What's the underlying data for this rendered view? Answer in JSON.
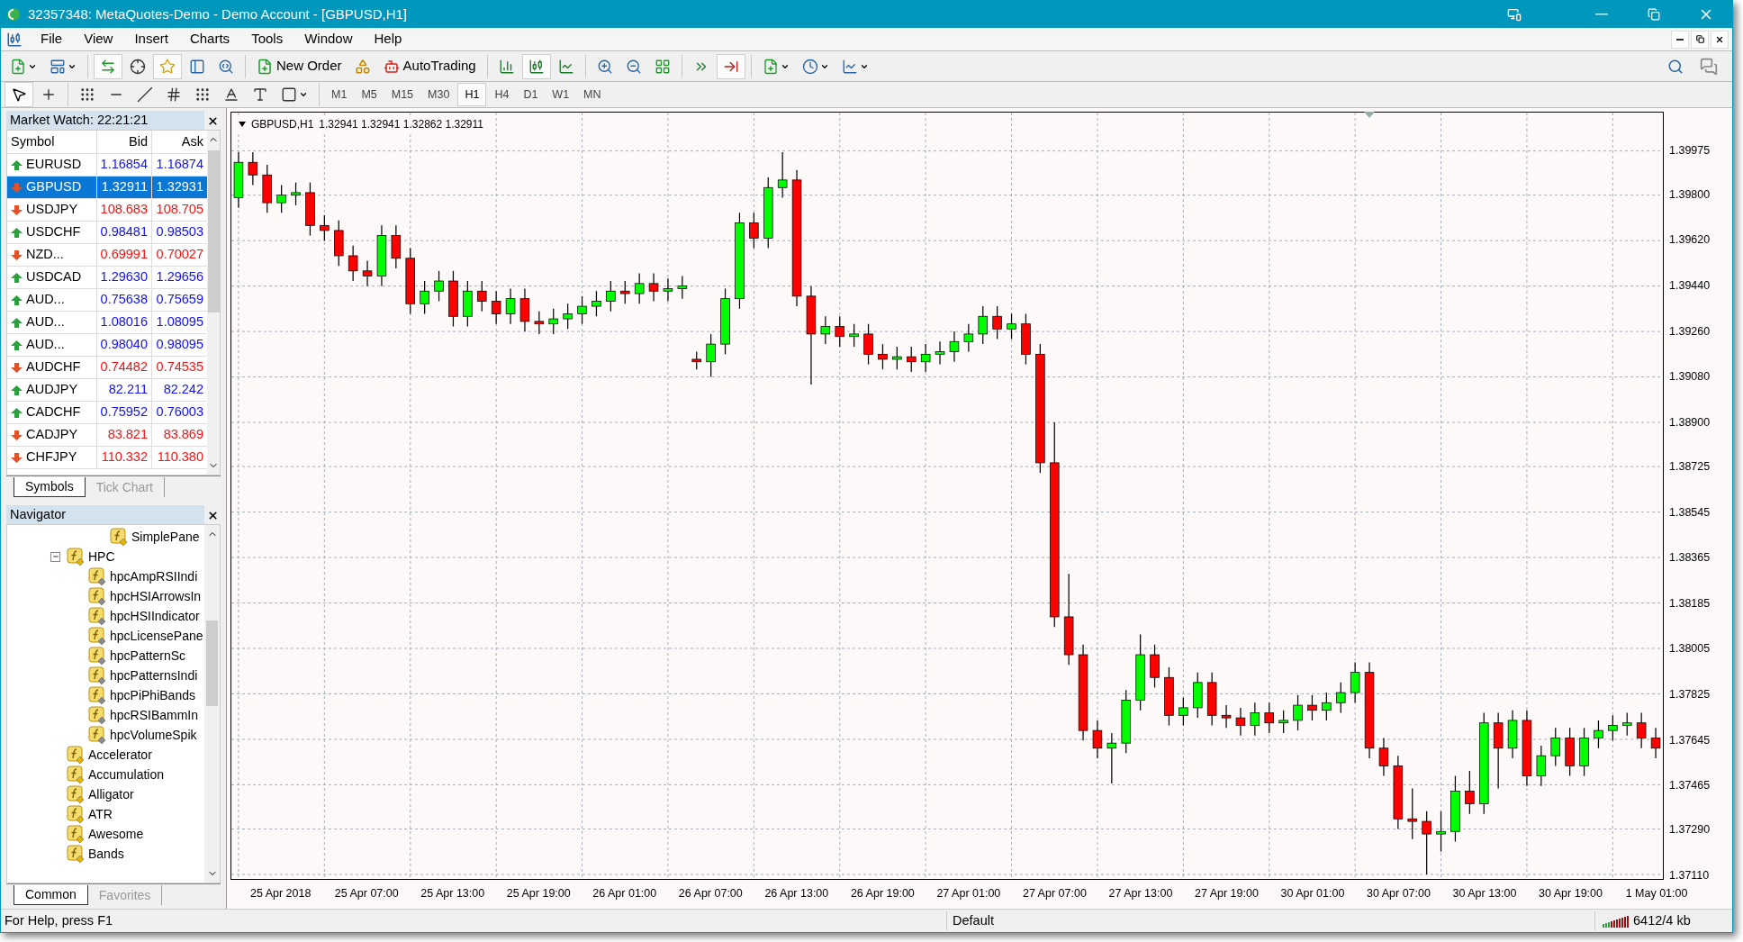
{
  "window": {
    "title": "32357348: MetaQuotes-Demo - Demo Account - [GBPUSD,H1]"
  },
  "menu": [
    "File",
    "View",
    "Insert",
    "Charts",
    "Tools",
    "Window",
    "Help"
  ],
  "toolbar": {
    "new_order": "New Order",
    "autotrading": "AutoTrading"
  },
  "timeframes": [
    {
      "label": "M1",
      "selected": false
    },
    {
      "label": "M5",
      "selected": false
    },
    {
      "label": "M15",
      "selected": false
    },
    {
      "label": "M30",
      "selected": false
    },
    {
      "label": "H1",
      "selected": true
    },
    {
      "label": "H4",
      "selected": false
    },
    {
      "label": "D1",
      "selected": false
    },
    {
      "label": "W1",
      "selected": false
    },
    {
      "label": "MN",
      "selected": false
    }
  ],
  "market_watch": {
    "title": "Market Watch: 22:21:21",
    "columns": [
      "Symbol",
      "Bid",
      "Ask"
    ],
    "rows": [
      {
        "symbol": "EURUSD",
        "bid": "1.16854",
        "ask": "1.16874",
        "rising": true,
        "selected": false
      },
      {
        "symbol": "GBPUSD",
        "bid": "1.32911",
        "ask": "1.32931",
        "rising": false,
        "selected": true
      },
      {
        "symbol": "USDJPY",
        "bid": "108.683",
        "ask": "108.705",
        "rising": false,
        "selected": false
      },
      {
        "symbol": "USDCHF",
        "bid": "0.98481",
        "ask": "0.98503",
        "rising": true,
        "selected": false
      },
      {
        "symbol": "NZD...",
        "bid": "0.69991",
        "ask": "0.70027",
        "rising": false,
        "selected": false
      },
      {
        "symbol": "USDCAD",
        "bid": "1.29630",
        "ask": "1.29656",
        "rising": true,
        "selected": false
      },
      {
        "symbol": "AUD...",
        "bid": "0.75638",
        "ask": "0.75659",
        "rising": true,
        "selected": false
      },
      {
        "symbol": "AUD...",
        "bid": "1.08016",
        "ask": "1.08095",
        "rising": true,
        "selected": false
      },
      {
        "symbol": "AUD...",
        "bid": "0.98040",
        "ask": "0.98095",
        "rising": true,
        "selected": false
      },
      {
        "symbol": "AUDCHF",
        "bid": "0.74482",
        "ask": "0.74535",
        "rising": false,
        "selected": false
      },
      {
        "symbol": "AUDJPY",
        "bid": "82.211",
        "ask": "82.242",
        "rising": true,
        "selected": false
      },
      {
        "symbol": "CADCHF",
        "bid": "0.75952",
        "ask": "0.76003",
        "rising": true,
        "selected": false
      },
      {
        "symbol": "CADJPY",
        "bid": "83.821",
        "ask": "83.869",
        "rising": false,
        "selected": false
      },
      {
        "symbol": "CHFJPY",
        "bid": "110.332",
        "ask": "110.380",
        "rising": false,
        "selected": false
      }
    ],
    "tabs": [
      {
        "label": "Symbols",
        "selected": true
      },
      {
        "label": "Tick Chart",
        "selected": false
      }
    ]
  },
  "navigator": {
    "title": "Navigator",
    "tree": [
      {
        "label": "SimplePane",
        "kind": "indicator"
      },
      {
        "label": "HPC",
        "kind": "folder",
        "expanded": true,
        "children": [
          {
            "label": "hpcAmpRSIIndi",
            "kind": "custom"
          },
          {
            "label": "hpcHSIArrowsIn",
            "kind": "custom"
          },
          {
            "label": "hpcHSIIndicator",
            "kind": "custom"
          },
          {
            "label": "hpcLicensePane",
            "kind": "custom"
          },
          {
            "label": "hpcPatternSc",
            "kind": "custom"
          },
          {
            "label": "hpcPatternsIndi",
            "kind": "custom"
          },
          {
            "label": "hpcPiPhiBands",
            "kind": "custom"
          },
          {
            "label": "hpcRSIBammIn",
            "kind": "custom"
          },
          {
            "label": "hpcVolumeSpik",
            "kind": "custom"
          }
        ]
      },
      {
        "label": "Accelerator",
        "kind": "indicator"
      },
      {
        "label": "Accumulation",
        "kind": "indicator"
      },
      {
        "label": "Alligator",
        "kind": "indicator"
      },
      {
        "label": "ATR",
        "kind": "indicator"
      },
      {
        "label": "Awesome",
        "kind": "indicator"
      },
      {
        "label": "Bands",
        "kind": "indicator"
      }
    ],
    "tabs": [
      {
        "label": "Common",
        "selected": true
      },
      {
        "label": "Favorites",
        "selected": false
      }
    ]
  },
  "chart": {
    "prices": "1.32941 1.32941 1.32862 1.32911",
    "chart_data": {
      "type": "candlestick",
      "ylim": [
        1.37092,
        1.40127
      ],
      "yticks": [
        {
          "value": 1.39975,
          "label": "1.39975"
        },
        {
          "value": 1.398,
          "label": "1.39800"
        },
        {
          "value": 1.3962,
          "label": "1.39620"
        },
        {
          "value": 1.3944,
          "label": "1.39440"
        },
        {
          "value": 1.3926,
          "label": "1.39260"
        },
        {
          "value": 1.3908,
          "label": "1.39080"
        },
        {
          "value": 1.389,
          "label": "1.38900"
        },
        {
          "value": 1.38725,
          "label": "1.38725"
        },
        {
          "value": 1.38545,
          "label": "1.38545"
        },
        {
          "value": 1.38365,
          "label": "1.38365"
        },
        {
          "value": 1.38185,
          "label": "1.38185"
        },
        {
          "value": 1.38005,
          "label": "1.38005"
        },
        {
          "value": 1.37825,
          "label": "1.37825"
        },
        {
          "value": 1.37645,
          "label": "1.37645"
        },
        {
          "value": 1.37465,
          "label": "1.37465"
        },
        {
          "value": 1.3729,
          "label": "1.37290"
        },
        {
          "value": 1.3711,
          "label": "1.37110"
        }
      ],
      "grid": true,
      "categories": [
        null,
        null,
        null,
        "25 Apr 2018",
        null,
        null,
        null,
        null,
        null,
        "25 Apr 07:00",
        null,
        null,
        null,
        null,
        null,
        "25 Apr 13:00",
        null,
        null,
        null,
        null,
        null,
        "25 Apr 19:00",
        null,
        null,
        null,
        null,
        null,
        "26 Apr 01:00",
        null,
        null,
        null,
        null,
        null,
        "26 Apr 07:00",
        null,
        null,
        null,
        null,
        null,
        "26 Apr 13:00",
        null,
        null,
        null,
        null,
        null,
        "26 Apr 19:00",
        null,
        null,
        null,
        null,
        null,
        "27 Apr 01:00",
        null,
        null,
        null,
        null,
        null,
        "27 Apr 07:00",
        null,
        null,
        null,
        null,
        null,
        "27 Apr 13:00",
        null,
        null,
        null,
        null,
        null,
        "27 Apr 19:00",
        null,
        null,
        null,
        null,
        null,
        "30 Apr 01:00",
        null,
        null,
        null,
        null,
        null,
        "30 Apr 07:00",
        null,
        null,
        null,
        null,
        null,
        "30 Apr 13:00",
        null,
        null,
        null,
        null,
        null,
        "30 Apr 19:00",
        null,
        null,
        null,
        null,
        null,
        "1 May 01:00"
      ],
      "series": [
        {
          "name": "GBPUSD,H1",
          "ohlc": [
            [
              1.3979,
              1.3997,
              1.3975,
              1.3993
            ],
            [
              1.3993,
              1.3997,
              1.3984,
              1.3988
            ],
            [
              1.3988,
              1.3992,
              1.3973,
              1.3977
            ],
            [
              1.3977,
              1.3984,
              1.3973,
              1.398
            ],
            [
              1.398,
              1.3985,
              1.3976,
              1.3981
            ],
            [
              1.3981,
              1.3985,
              1.3964,
              1.3968
            ],
            [
              1.3968,
              1.3972,
              1.3962,
              1.3966
            ],
            [
              1.3966,
              1.397,
              1.3952,
              1.3956
            ],
            [
              1.3956,
              1.396,
              1.3946,
              1.395
            ],
            [
              1.395,
              1.3954,
              1.3944,
              1.3948
            ],
            [
              1.3948,
              1.3968,
              1.3944,
              1.3964
            ],
            [
              1.3964,
              1.3968,
              1.3951,
              1.3955
            ],
            [
              1.3955,
              1.3959,
              1.3933,
              1.3937
            ],
            [
              1.3937,
              1.3946,
              1.3933,
              1.3942
            ],
            [
              1.3942,
              1.395,
              1.3938,
              1.3946
            ],
            [
              1.3946,
              1.395,
              1.3928,
              1.3932
            ],
            [
              1.3932,
              1.3946,
              1.3928,
              1.3942
            ],
            [
              1.3942,
              1.3946,
              1.3934,
              1.3938
            ],
            [
              1.3938,
              1.3942,
              1.3929,
              1.3933
            ],
            [
              1.3933,
              1.3943,
              1.3929,
              1.3939
            ],
            [
              1.3939,
              1.3943,
              1.3926,
              1.393
            ],
            [
              1.393,
              1.3934,
              1.3925,
              1.3929
            ],
            [
              1.3929,
              1.3935,
              1.3925,
              1.3931
            ],
            [
              1.3931,
              1.3937,
              1.3927,
              1.3933
            ],
            [
              1.3933,
              1.394,
              1.3929,
              1.3936
            ],
            [
              1.3936,
              1.3942,
              1.3932,
              1.3938
            ],
            [
              1.3938,
              1.3946,
              1.3934,
              1.3942
            ],
            [
              1.3942,
              1.3946,
              1.3937,
              1.3941
            ],
            [
              1.3941,
              1.3949,
              1.3937,
              1.3945
            ],
            [
              1.3945,
              1.3949,
              1.3938,
              1.3942
            ],
            [
              1.3942,
              1.3947,
              1.3938,
              1.3943
            ],
            [
              1.3943,
              1.3948,
              1.3939,
              1.3944
            ],
            [
              1.3915,
              1.3918,
              1.3911,
              1.3914
            ],
            [
              1.3914,
              1.3925,
              1.3908,
              1.3921
            ],
            [
              1.3921,
              1.3943,
              1.3917,
              1.3939
            ],
            [
              1.3939,
              1.3973,
              1.3935,
              1.3969
            ],
            [
              1.3969,
              1.3973,
              1.3959,
              1.3963
            ],
            [
              1.3963,
              1.3987,
              1.3959,
              1.3983
            ],
            [
              1.3983,
              1.3997,
              1.3979,
              1.3986
            ],
            [
              1.3986,
              1.399,
              1.3936,
              1.394
            ],
            [
              1.394,
              1.3944,
              1.3905,
              1.3925
            ],
            [
              1.3925,
              1.3932,
              1.3921,
              1.3928
            ],
            [
              1.3928,
              1.3932,
              1.392,
              1.3924
            ],
            [
              1.3924,
              1.3929,
              1.392,
              1.3925
            ],
            [
              1.3925,
              1.3929,
              1.3913,
              1.3917
            ],
            [
              1.3917,
              1.3921,
              1.3911,
              1.3915
            ],
            [
              1.3915,
              1.392,
              1.3911,
              1.3916
            ],
            [
              1.3916,
              1.392,
              1.391,
              1.3914
            ],
            [
              1.3914,
              1.3921,
              1.391,
              1.3917
            ],
            [
              1.3917,
              1.3922,
              1.3913,
              1.3918
            ],
            [
              1.3918,
              1.3926,
              1.3914,
              1.3922
            ],
            [
              1.3922,
              1.3929,
              1.3918,
              1.3925
            ],
            [
              1.3925,
              1.3936,
              1.3921,
              1.3932
            ],
            [
              1.3932,
              1.3936,
              1.3923,
              1.3927
            ],
            [
              1.3927,
              1.3933,
              1.3923,
              1.3929
            ],
            [
              1.3929,
              1.3933,
              1.3913,
              1.3917
            ],
            [
              1.3917,
              1.3921,
              1.387,
              1.3874
            ],
            [
              1.3874,
              1.389,
              1.3809,
              1.3813
            ],
            [
              1.3813,
              1.383,
              1.3794,
              1.3798
            ],
            [
              1.3798,
              1.3802,
              1.3764,
              1.3768
            ],
            [
              1.3768,
              1.3772,
              1.3757,
              1.3761
            ],
            [
              1.3761,
              1.3767,
              1.3747,
              1.3763
            ],
            [
              1.3763,
              1.3784,
              1.3759,
              1.378
            ],
            [
              1.378,
              1.3806,
              1.3776,
              1.3798
            ],
            [
              1.3798,
              1.3802,
              1.3785,
              1.3789
            ],
            [
              1.3789,
              1.3793,
              1.377,
              1.3774
            ],
            [
              1.3774,
              1.3781,
              1.377,
              1.3777
            ],
            [
              1.3777,
              1.3791,
              1.3773,
              1.3787
            ],
            [
              1.3787,
              1.3791,
              1.377,
              1.3774
            ],
            [
              1.3774,
              1.3778,
              1.3769,
              1.3773
            ],
            [
              1.3773,
              1.3777,
              1.3766,
              1.377
            ],
            [
              1.377,
              1.3779,
              1.3766,
              1.3775
            ],
            [
              1.3775,
              1.3779,
              1.3767,
              1.3771
            ],
            [
              1.3771,
              1.3776,
              1.3767,
              1.3772
            ],
            [
              1.3772,
              1.3782,
              1.3768,
              1.3778
            ],
            [
              1.3778,
              1.3782,
              1.3772,
              1.3776
            ],
            [
              1.3776,
              1.3783,
              1.3772,
              1.3779
            ],
            [
              1.3779,
              1.3787,
              1.3775,
              1.3783
            ],
            [
              1.3783,
              1.3795,
              1.3779,
              1.3791
            ],
            [
              1.3791,
              1.3795,
              1.3757,
              1.3761
            ],
            [
              1.3761,
              1.3765,
              1.375,
              1.3754
            ],
            [
              1.3754,
              1.3758,
              1.3729,
              1.3733
            ],
            [
              1.3733,
              1.3745,
              1.3725,
              1.3732
            ],
            [
              1.3732,
              1.3736,
              1.3711,
              1.3727
            ],
            [
              1.3727,
              1.3736,
              1.372,
              1.3728
            ],
            [
              1.3728,
              1.375,
              1.3724,
              1.3744
            ],
            [
              1.3744,
              1.3752,
              1.3735,
              1.3739
            ],
            [
              1.3739,
              1.3775,
              1.3735,
              1.3771
            ],
            [
              1.3771,
              1.3775,
              1.3745,
              1.3761
            ],
            [
              1.3761,
              1.3776,
              1.3757,
              1.3772
            ],
            [
              1.3772,
              1.3776,
              1.3746,
              1.375
            ],
            [
              1.375,
              1.3762,
              1.3746,
              1.3758
            ],
            [
              1.3758,
              1.3769,
              1.3754,
              1.3765
            ],
            [
              1.3765,
              1.3769,
              1.375,
              1.3754
            ],
            [
              1.3754,
              1.3769,
              1.375,
              1.3765
            ],
            [
              1.3765,
              1.3772,
              1.3761,
              1.3768
            ],
            [
              1.3768,
              1.3774,
              1.3764,
              1.377
            ],
            [
              1.377,
              1.3775,
              1.3766,
              1.3771
            ],
            [
              1.3771,
              1.3775,
              1.3761,
              1.3765
            ],
            [
              1.3765,
              1.3769,
              1.3757,
              1.3761
            ]
          ]
        }
      ]
    }
  },
  "status_bar": {
    "help": "For Help, press F1",
    "profile": "Default",
    "traffic": "6412/4 kb"
  }
}
